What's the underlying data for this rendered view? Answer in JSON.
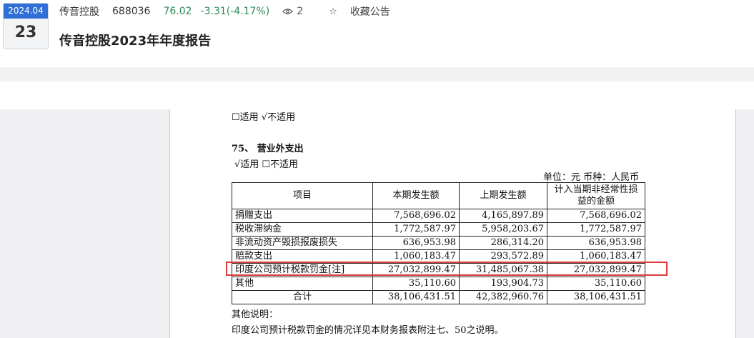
{
  "header": {
    "date_month": "2024.04",
    "date_day": "23",
    "stock_name": "传音控股",
    "stock_code": "688036",
    "price": "76.02",
    "change": "-3.31(-4.17%)",
    "views": "2",
    "favorite_label": "收藏公告",
    "report_title": "传音控股2023年年度报告"
  },
  "doc": {
    "prev_applicability": "☐适用  √不适用",
    "section_title": "75、  营业外支出",
    "applicability": "√适用  ☐不适用",
    "unit_line": "单位：元  币种：人民币",
    "table": {
      "headers": [
        "项目",
        "本期发生额",
        "上期发生额",
        "计入当期非经常性损益的金额"
      ],
      "rows": [
        {
          "item": "捐赠支出",
          "current": "7,568,696.02",
          "previous": "4,165,897.89",
          "nonrecurring": "7,568,696.02"
        },
        {
          "item": "税收滞纳金",
          "current": "1,772,587.97",
          "previous": "5,958,203.67",
          "nonrecurring": "1,772,587.97"
        },
        {
          "item": "非流动资产毁损报废损失",
          "current": "636,953.98",
          "previous": "286,314.20",
          "nonrecurring": "636,953.98"
        },
        {
          "item": "赔款支出",
          "current": "1,060,183.47",
          "previous": "293,572.89",
          "nonrecurring": "1,060,183.47"
        },
        {
          "item": "印度公司预计税款罚金[注]",
          "current": "27,032,899.47",
          "previous": "31,485,067.38",
          "nonrecurring": "27,032,899.47"
        },
        {
          "item": "其他",
          "current": "35,110.60",
          "previous": "193,904.73",
          "nonrecurring": "35,110.60"
        }
      ],
      "total": {
        "item": "合计",
        "current": "38,106,431.51",
        "previous": "42,382,960.76",
        "nonrecurring": "38,106,431.51"
      }
    },
    "other_notes_label": "其他说明：",
    "note_text": "印度公司预计税款罚金的情况详见本财务报表附注七、50之说明。"
  }
}
